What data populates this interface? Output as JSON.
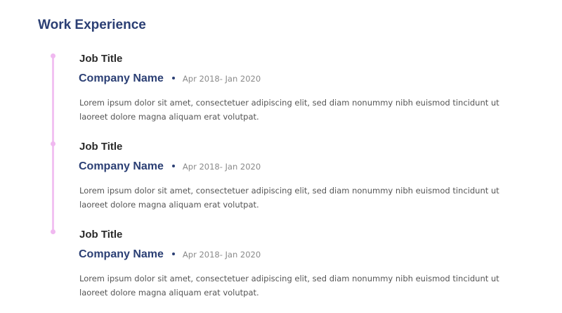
{
  "section": {
    "title": "Work Experience",
    "accent_color": "#2b3f74",
    "timeline_color": "#f2c2f2"
  },
  "experience": [
    {
      "job_title": "Job Title",
      "company": "Company Name",
      "dates": "Apr 2018- Jan 2020",
      "description": "Lorem ipsum dolor sit amet, consectetuer adipiscing elit, sed diam nonummy nibh euismod tincidunt ut laoreet dolore magna aliquam erat volutpat."
    },
    {
      "job_title": "Job Title",
      "company": "Company Name",
      "dates": "Apr 2018- Jan 2020",
      "description": "Lorem ipsum dolor sit amet, consectetuer adipiscing elit, sed diam nonummy nibh euismod tincidunt ut laoreet dolore magna aliquam erat volutpat."
    },
    {
      "job_title": "Job Title",
      "company": "Company Name",
      "dates": "Apr 2018- Jan 2020",
      "description": "Lorem ipsum dolor sit amet, consectetuer adipiscing elit, sed diam nonummy nibh euismod tincidunt ut laoreet dolore magna aliquam erat volutpat."
    }
  ]
}
